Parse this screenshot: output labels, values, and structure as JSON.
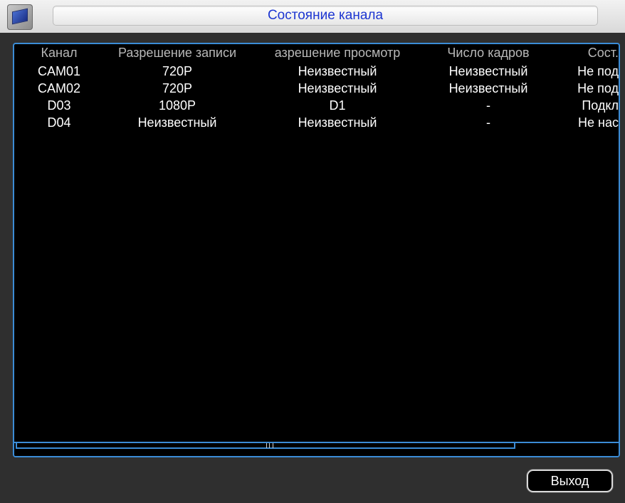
{
  "window": {
    "title": "Состояние канала"
  },
  "table": {
    "headers": [
      "Канал",
      "Разрешение записи",
      "азрешение просмотр",
      "Число кадров",
      "Сост."
    ],
    "rows": [
      [
        "CAM01",
        "720P",
        "Неизвестный",
        "Неизвестный",
        "Не под"
      ],
      [
        "CAM02",
        "720P",
        "Неизвестный",
        "Неизвестный",
        "Не под"
      ],
      [
        "D03",
        "1080P",
        "D1",
        "-",
        "Подкл"
      ],
      [
        "D04",
        "Неизвестный",
        "Неизвестный",
        "-",
        "Не нас"
      ]
    ]
  },
  "buttons": {
    "exit_label": "Выход"
  },
  "colors": {
    "title_text": "#1d36d1",
    "border_accent": "#3b8cd6",
    "panel_bg": "#000000"
  },
  "icons": {
    "app": "monitor-icon"
  }
}
